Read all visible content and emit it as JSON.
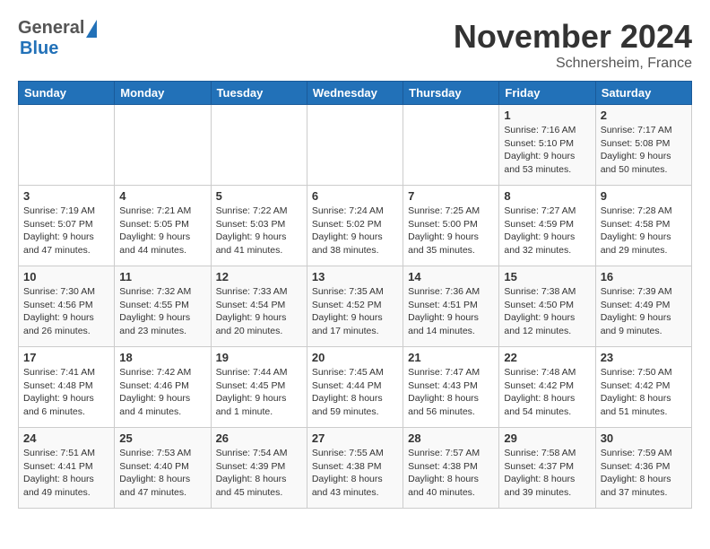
{
  "logo": {
    "general": "General",
    "blue": "Blue"
  },
  "title": "November 2024",
  "location": "Schnersheim, France",
  "days_of_week": [
    "Sunday",
    "Monday",
    "Tuesday",
    "Wednesday",
    "Thursday",
    "Friday",
    "Saturday"
  ],
  "weeks": [
    [
      {
        "day": "",
        "info": ""
      },
      {
        "day": "",
        "info": ""
      },
      {
        "day": "",
        "info": ""
      },
      {
        "day": "",
        "info": ""
      },
      {
        "day": "",
        "info": ""
      },
      {
        "day": "1",
        "info": "Sunrise: 7:16 AM\nSunset: 5:10 PM\nDaylight: 9 hours\nand 53 minutes."
      },
      {
        "day": "2",
        "info": "Sunrise: 7:17 AM\nSunset: 5:08 PM\nDaylight: 9 hours\nand 50 minutes."
      }
    ],
    [
      {
        "day": "3",
        "info": "Sunrise: 7:19 AM\nSunset: 5:07 PM\nDaylight: 9 hours\nand 47 minutes."
      },
      {
        "day": "4",
        "info": "Sunrise: 7:21 AM\nSunset: 5:05 PM\nDaylight: 9 hours\nand 44 minutes."
      },
      {
        "day": "5",
        "info": "Sunrise: 7:22 AM\nSunset: 5:03 PM\nDaylight: 9 hours\nand 41 minutes."
      },
      {
        "day": "6",
        "info": "Sunrise: 7:24 AM\nSunset: 5:02 PM\nDaylight: 9 hours\nand 38 minutes."
      },
      {
        "day": "7",
        "info": "Sunrise: 7:25 AM\nSunset: 5:00 PM\nDaylight: 9 hours\nand 35 minutes."
      },
      {
        "day": "8",
        "info": "Sunrise: 7:27 AM\nSunset: 4:59 PM\nDaylight: 9 hours\nand 32 minutes."
      },
      {
        "day": "9",
        "info": "Sunrise: 7:28 AM\nSunset: 4:58 PM\nDaylight: 9 hours\nand 29 minutes."
      }
    ],
    [
      {
        "day": "10",
        "info": "Sunrise: 7:30 AM\nSunset: 4:56 PM\nDaylight: 9 hours\nand 26 minutes."
      },
      {
        "day": "11",
        "info": "Sunrise: 7:32 AM\nSunset: 4:55 PM\nDaylight: 9 hours\nand 23 minutes."
      },
      {
        "day": "12",
        "info": "Sunrise: 7:33 AM\nSunset: 4:54 PM\nDaylight: 9 hours\nand 20 minutes."
      },
      {
        "day": "13",
        "info": "Sunrise: 7:35 AM\nSunset: 4:52 PM\nDaylight: 9 hours\nand 17 minutes."
      },
      {
        "day": "14",
        "info": "Sunrise: 7:36 AM\nSunset: 4:51 PM\nDaylight: 9 hours\nand 14 minutes."
      },
      {
        "day": "15",
        "info": "Sunrise: 7:38 AM\nSunset: 4:50 PM\nDaylight: 9 hours\nand 12 minutes."
      },
      {
        "day": "16",
        "info": "Sunrise: 7:39 AM\nSunset: 4:49 PM\nDaylight: 9 hours\nand 9 minutes."
      }
    ],
    [
      {
        "day": "17",
        "info": "Sunrise: 7:41 AM\nSunset: 4:48 PM\nDaylight: 9 hours\nand 6 minutes."
      },
      {
        "day": "18",
        "info": "Sunrise: 7:42 AM\nSunset: 4:46 PM\nDaylight: 9 hours\nand 4 minutes."
      },
      {
        "day": "19",
        "info": "Sunrise: 7:44 AM\nSunset: 4:45 PM\nDaylight: 9 hours\nand 1 minute."
      },
      {
        "day": "20",
        "info": "Sunrise: 7:45 AM\nSunset: 4:44 PM\nDaylight: 8 hours\nand 59 minutes."
      },
      {
        "day": "21",
        "info": "Sunrise: 7:47 AM\nSunset: 4:43 PM\nDaylight: 8 hours\nand 56 minutes."
      },
      {
        "day": "22",
        "info": "Sunrise: 7:48 AM\nSunset: 4:42 PM\nDaylight: 8 hours\nand 54 minutes."
      },
      {
        "day": "23",
        "info": "Sunrise: 7:50 AM\nSunset: 4:42 PM\nDaylight: 8 hours\nand 51 minutes."
      }
    ],
    [
      {
        "day": "24",
        "info": "Sunrise: 7:51 AM\nSunset: 4:41 PM\nDaylight: 8 hours\nand 49 minutes."
      },
      {
        "day": "25",
        "info": "Sunrise: 7:53 AM\nSunset: 4:40 PM\nDaylight: 8 hours\nand 47 minutes."
      },
      {
        "day": "26",
        "info": "Sunrise: 7:54 AM\nSunset: 4:39 PM\nDaylight: 8 hours\nand 45 minutes."
      },
      {
        "day": "27",
        "info": "Sunrise: 7:55 AM\nSunset: 4:38 PM\nDaylight: 8 hours\nand 43 minutes."
      },
      {
        "day": "28",
        "info": "Sunrise: 7:57 AM\nSunset: 4:38 PM\nDaylight: 8 hours\nand 40 minutes."
      },
      {
        "day": "29",
        "info": "Sunrise: 7:58 AM\nSunset: 4:37 PM\nDaylight: 8 hours\nand 39 minutes."
      },
      {
        "day": "30",
        "info": "Sunrise: 7:59 AM\nSunset: 4:36 PM\nDaylight: 8 hours\nand 37 minutes."
      }
    ]
  ]
}
